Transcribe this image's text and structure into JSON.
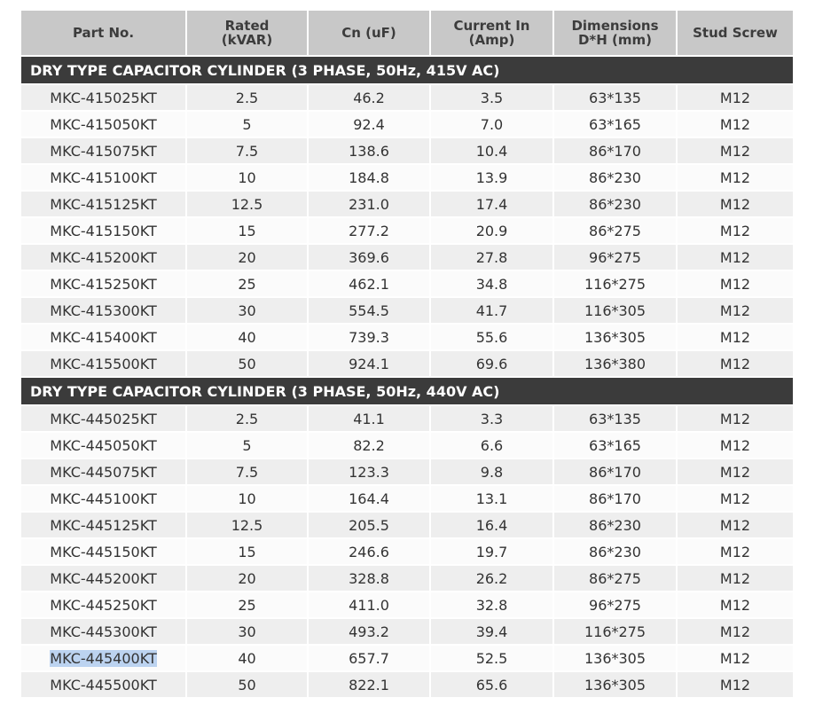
{
  "headers": [
    [
      "Part No."
    ],
    [
      "Rated",
      "(kVAR)"
    ],
    [
      "Cn (uF)"
    ],
    [
      "Current In",
      "(Amp)"
    ],
    [
      "Dimensions",
      "D*H (mm)"
    ],
    [
      "Stud Screw"
    ]
  ],
  "sections": [
    {
      "title": "DRY TYPE CAPACITOR CYLINDER (3 PHASE, 50Hz, 415V AC)",
      "rows": [
        [
          "MKC-415025KT",
          "2.5",
          "46.2",
          "3.5",
          "63*135",
          "M12"
        ],
        [
          "MKC-415050KT",
          "5",
          "92.4",
          "7.0",
          "63*165",
          "M12"
        ],
        [
          "MKC-415075KT",
          "7.5",
          "138.6",
          "10.4",
          "86*170",
          "M12"
        ],
        [
          "MKC-415100KT",
          "10",
          "184.8",
          "13.9",
          "86*230",
          "M12"
        ],
        [
          "MKC-415125KT",
          "12.5",
          "231.0",
          "17.4",
          "86*230",
          "M12"
        ],
        [
          "MKC-415150KT",
          "15",
          "277.2",
          "20.9",
          "86*275",
          "M12"
        ],
        [
          "MKC-415200KT",
          "20",
          "369.6",
          "27.8",
          "96*275",
          "M12"
        ],
        [
          "MKC-415250KT",
          "25",
          "462.1",
          "34.8",
          "116*275",
          "M12"
        ],
        [
          "MKC-415300KT",
          "30",
          "554.5",
          "41.7",
          "116*305",
          "M12"
        ],
        [
          "MKC-415400KT",
          "40",
          "739.3",
          "55.6",
          "136*305",
          "M12"
        ],
        [
          "MKC-415500KT",
          "50",
          "924.1",
          "69.6",
          "136*380",
          "M12"
        ]
      ]
    },
    {
      "title": "DRY TYPE CAPACITOR CYLINDER (3 PHASE, 50Hz, 440V AC)",
      "rows": [
        [
          "MKC-445025KT",
          "2.5",
          "41.1",
          "3.3",
          "63*135",
          "M12"
        ],
        [
          "MKC-445050KT",
          "5",
          "82.2",
          "6.6",
          "63*165",
          "M12"
        ],
        [
          "MKC-445075KT",
          "7.5",
          "123.3",
          "9.8",
          "86*170",
          "M12"
        ],
        [
          "MKC-445100KT",
          "10",
          "164.4",
          "13.1",
          "86*170",
          "M12"
        ],
        [
          "MKC-445125KT",
          "12.5",
          "205.5",
          "16.4",
          "86*230",
          "M12"
        ],
        [
          "MKC-445150KT",
          "15",
          "246.6",
          "19.7",
          "86*230",
          "M12"
        ],
        [
          "MKC-445200KT",
          "20",
          "328.8",
          "26.2",
          "86*275",
          "M12"
        ],
        [
          "MKC-445250KT",
          "25",
          "411.0",
          "32.8",
          "96*275",
          "M12"
        ],
        [
          "MKC-445300KT",
          "30",
          "493.2",
          "39.4",
          "116*275",
          "M12"
        ],
        [
          "MKC-445400KT",
          "40",
          "657.7",
          "52.5",
          "136*305",
          "M12"
        ],
        [
          "MKC-445500KT",
          "50",
          "822.1",
          "65.6",
          "136*305",
          "M12"
        ]
      ]
    }
  ],
  "selection": {
    "section": 1,
    "row": 9,
    "col": 0
  },
  "colors": {
    "header_bg": "#c8c8c8",
    "section_bg": "#3b3b3b",
    "row_odd": "#eeeeee",
    "row_even": "#fbfbfb",
    "selection": "#bcd3f0"
  }
}
